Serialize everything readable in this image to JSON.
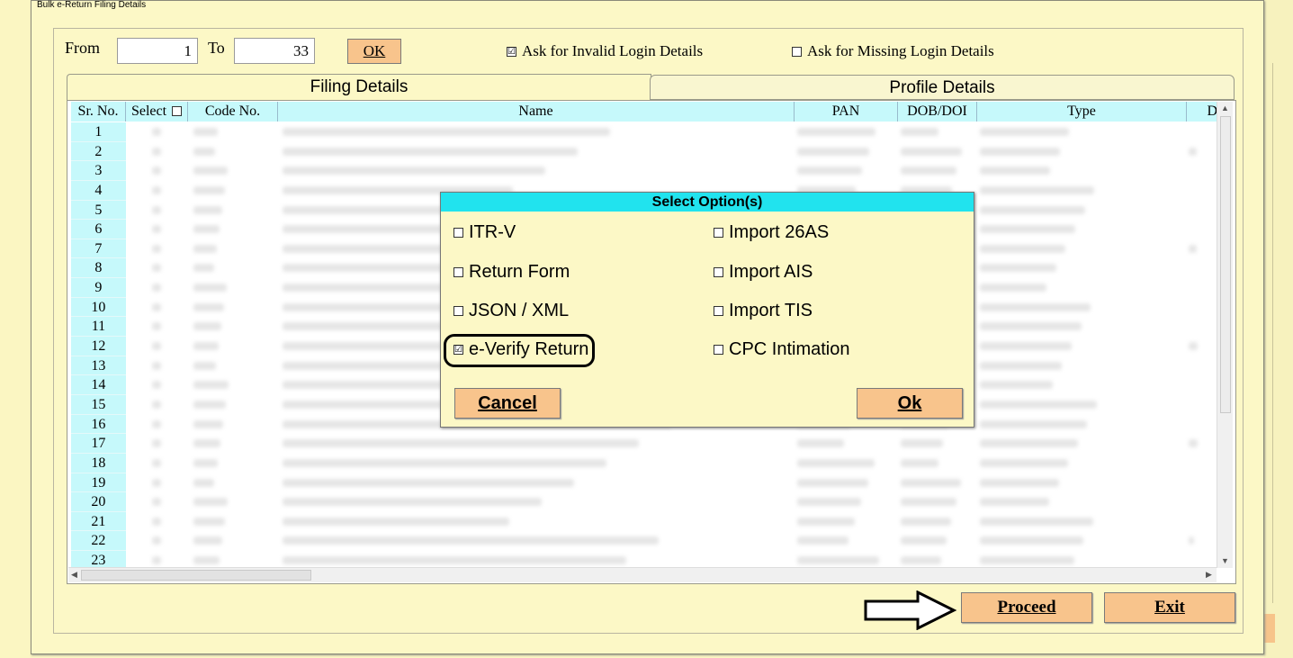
{
  "window": {
    "title": "Bulk e-Return Filing Details"
  },
  "range": {
    "from_label": "From",
    "from_value": "1",
    "to_label": "To",
    "to_value": "33",
    "ok_label": "OK"
  },
  "options": {
    "invalid_login": {
      "label": "Ask for Invalid Login Details",
      "checked": true
    },
    "missing_login": {
      "label": "Ask for Missing Login Details",
      "checked": false
    }
  },
  "tabs": [
    {
      "label": "Filing Details",
      "active": true
    },
    {
      "label": "Profile Details",
      "active": false
    }
  ],
  "grid": {
    "columns": [
      "Sr. No.",
      "Select",
      "Code No.",
      "Name",
      "PAN",
      "DOB/DOI",
      "Type",
      "D"
    ],
    "rows": [
      "1",
      "2",
      "3",
      "4",
      "5",
      "6",
      "7",
      "8",
      "9",
      "10",
      "11",
      "12",
      "13",
      "14",
      "15",
      "16",
      "17",
      "18",
      "19",
      "20",
      "21",
      "22",
      "23"
    ]
  },
  "dialog": {
    "title": "Select Option(s)",
    "left_options": [
      {
        "label": "ITR-V",
        "checked": false
      },
      {
        "label": "Return Form",
        "checked": false
      },
      {
        "label": "JSON / XML",
        "checked": false
      },
      {
        "label": "e-Verify Return",
        "checked": true
      }
    ],
    "right_options": [
      {
        "label": "Import 26AS",
        "checked": false
      },
      {
        "label": "Import AIS",
        "checked": false
      },
      {
        "label": "Import TIS",
        "checked": false
      },
      {
        "label": "CPC Intimation",
        "checked": false
      }
    ],
    "cancel_label": "Cancel",
    "ok_label": "Ok"
  },
  "actions": {
    "proceed_label": "Proceed",
    "exit_label": "Exit"
  },
  "icons": {
    "checked": "☑",
    "unchecked": "☐"
  }
}
